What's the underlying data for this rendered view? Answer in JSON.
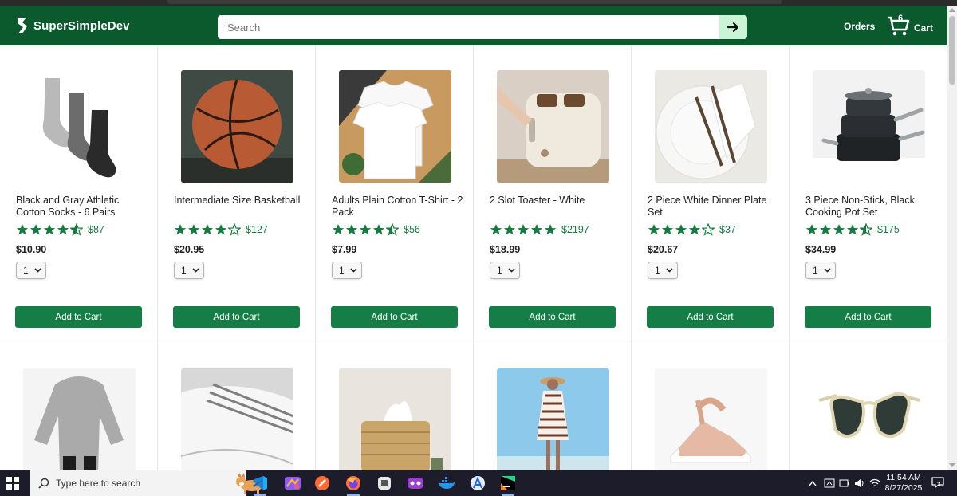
{
  "header": {
    "brand": "SuperSimpleDev",
    "search_placeholder": "Search",
    "orders_label": "Orders",
    "cart_label": "Cart",
    "cart_count": "6"
  },
  "colors": {
    "header_bg": "#0b5a2e",
    "accent_green": "#157e47",
    "rating_green": "#157a3f",
    "search_button_bg": "#c9f5d6"
  },
  "products": [
    {
      "name": "Black and Gray Athletic Cotton Socks - 6 Pairs",
      "stars": 4.5,
      "rating_count": "87",
      "price": "$10.90",
      "qty": "1",
      "add_label": "Add to Cart",
      "image": "socks"
    },
    {
      "name": "Intermediate Size Basketball",
      "stars": 4,
      "rating_count": "127",
      "price": "$20.95",
      "qty": "1",
      "add_label": "Add to Cart",
      "image": "basketball"
    },
    {
      "name": "Adults Plain Cotton T-Shirt - 2 Pack",
      "stars": 4.5,
      "rating_count": "56",
      "price": "$7.99",
      "qty": "1",
      "add_label": "Add to Cart",
      "image": "tshirt"
    },
    {
      "name": "2 Slot Toaster - White",
      "stars": 5,
      "rating_count": "2197",
      "price": "$18.99",
      "qty": "1",
      "add_label": "Add to Cart",
      "image": "toaster"
    },
    {
      "name": "2 Piece White Dinner Plate Set",
      "stars": 4,
      "rating_count": "37",
      "price": "$20.67",
      "qty": "1",
      "add_label": "Add to Cart",
      "image": "plate"
    },
    {
      "name": "3 Piece Non-Stick, Black Cooking Pot Set",
      "stars": 4.5,
      "rating_count": "175",
      "price": "$34.99",
      "qty": "1",
      "add_label": "Add to Cart",
      "image": "pots"
    }
  ],
  "products_row2": [
    {
      "image": "sweater"
    },
    {
      "image": "towels"
    },
    {
      "image": "tissue-box"
    },
    {
      "image": "beach-dress"
    },
    {
      "image": "sandals"
    },
    {
      "image": "sunglasses"
    }
  ],
  "taskbar": {
    "search_placeholder": "Type here to search",
    "time": "11:54 AM",
    "date": "8/27/2025",
    "notification_count": "3"
  }
}
